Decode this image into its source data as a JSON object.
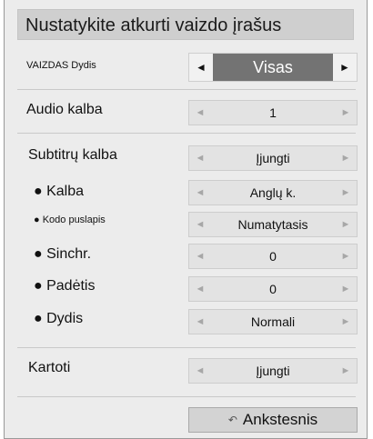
{
  "title": "Nustatykite atkurti vaizdo įrašus",
  "rows": {
    "vaizdas": {
      "label": "VAIZDAS Dydis",
      "value": "Visas"
    },
    "audio": {
      "label": "Audio kalba",
      "value": "1"
    },
    "subtitrai": {
      "label": "Subtitrų kalba",
      "value": "Įjungti"
    },
    "kalba": {
      "label": "● Kalba",
      "value": "Anglų k."
    },
    "kodo": {
      "label": "● Kodo puslapis",
      "value": "Numatytasis"
    },
    "sinchr": {
      "label": "● Sinchr.",
      "value": "0"
    },
    "padetis": {
      "label": "● Padėtis",
      "value": "0"
    },
    "dydis": {
      "label": "● Dydis",
      "value": "Normali"
    },
    "kartoti": {
      "label": "Kartoti",
      "value": "Įjungti"
    }
  },
  "arrows": {
    "left": "◄",
    "right": "►"
  },
  "back_button": {
    "label": "Ankstesnis",
    "icon": "↶",
    "icon_name": "return-icon"
  }
}
